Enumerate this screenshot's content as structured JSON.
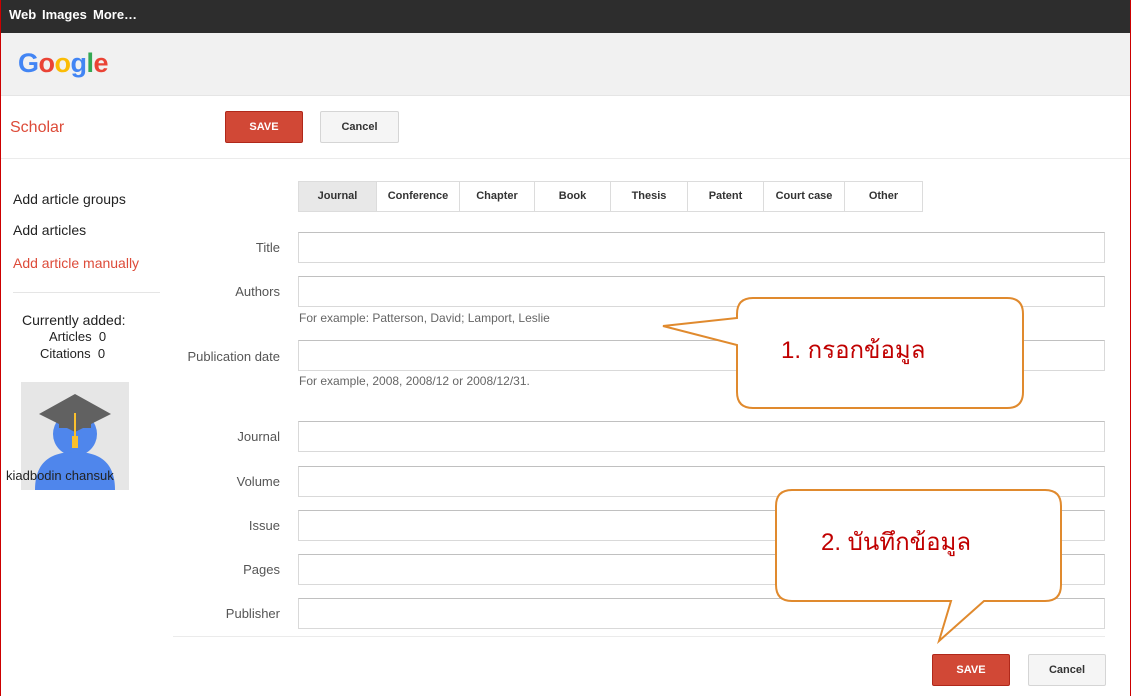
{
  "topbar": {
    "links": [
      "Web",
      "Images",
      "More…"
    ]
  },
  "logo": [
    "G",
    "o",
    "o",
    "g",
    "l",
    "e"
  ],
  "subbar": {
    "title": "Scholar",
    "save": "SAVE",
    "cancel": "Cancel"
  },
  "sidebar": {
    "items": [
      "Add article groups",
      "Add articles",
      "Add article manually"
    ],
    "currently_added": "Currently added:",
    "articles_label": "Articles",
    "articles_count": "0",
    "citations_label": "Citations",
    "citations_count": "0",
    "username": "kiadbodin chansuk"
  },
  "tabs": [
    "Journal",
    "Conference",
    "Chapter",
    "Book",
    "Thesis",
    "Patent",
    "Court case",
    "Other"
  ],
  "form": {
    "title": "Title",
    "authors": "Authors",
    "authors_hint": "For example: Patterson, David; Lamport, Leslie",
    "pubdate": "Publication date",
    "pubdate_hint": "For example, 2008, 2008/12 or 2008/12/31.",
    "journal": "Journal",
    "volume": "Volume",
    "issue": "Issue",
    "pages": "Pages",
    "publisher": "Publisher"
  },
  "bottom": {
    "save": "SAVE",
    "cancel": "Cancel"
  },
  "callouts": {
    "one": "1.   กรอกข้อมูล",
    "two": "2.   บันทึกข้อมูล"
  },
  "colors": {
    "accent": "#dd4b39",
    "callout_border": "#e08a2e",
    "callout_text": "#c00000"
  }
}
